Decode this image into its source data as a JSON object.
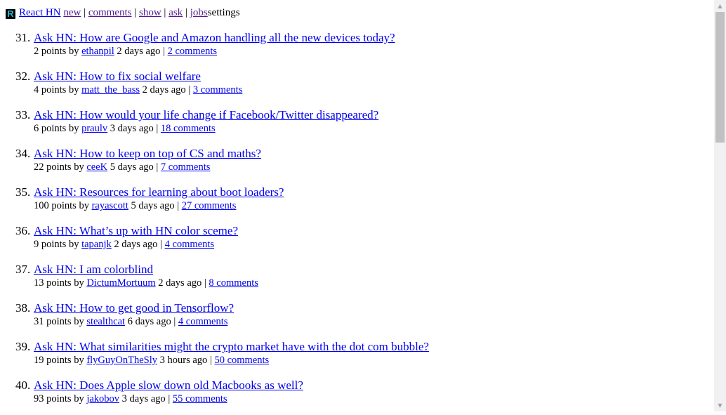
{
  "header": {
    "logo_letter": "R",
    "brand": "React HN",
    "nav": [
      {
        "label": "new",
        "visited": true
      },
      {
        "label": "comments",
        "visited": true
      },
      {
        "label": "show",
        "visited": true
      },
      {
        "label": "ask",
        "visited": true
      },
      {
        "label": "jobs",
        "visited": true
      }
    ],
    "separator": "|",
    "settings": "settings"
  },
  "stories": [
    {
      "rank": "31.",
      "title": "Ask HN: How are Google and Amazon handling all the new devices today?",
      "points": "2 points",
      "by": "by",
      "user": "ethanpil",
      "age": "2 days ago",
      "comments": "2 comments"
    },
    {
      "rank": "32.",
      "title": "Ask HN: How to fix social welfare",
      "points": "4 points",
      "by": "by",
      "user": "matt_the_bass",
      "age": "2 days ago",
      "comments": "3 comments"
    },
    {
      "rank": "33.",
      "title": "Ask HN: How would your life change if Facebook/Twitter disappeared?",
      "points": "6 points",
      "by": "by",
      "user": "praulv",
      "age": "3 days ago",
      "comments": "18 comments"
    },
    {
      "rank": "34.",
      "title": "Ask HN: How to keep on top of CS and maths?",
      "points": "22 points",
      "by": "by",
      "user": "ceeK",
      "age": "5 days ago",
      "comments": "7 comments"
    },
    {
      "rank": "35.",
      "title": "Ask HN: Resources for learning about boot loaders?",
      "points": "100 points",
      "by": "by",
      "user": "rayascott",
      "age": "5 days ago",
      "comments": "27 comments"
    },
    {
      "rank": "36.",
      "title": "Ask HN: What’s up with HN color sceme?",
      "points": "9 points",
      "by": "by",
      "user": "tapanjk",
      "age": "2 days ago",
      "comments": "4 comments"
    },
    {
      "rank": "37.",
      "title": "Ask HN: I am colorblind",
      "points": "13 points",
      "by": "by",
      "user": "DictumMortuum",
      "age": "2 days ago",
      "comments": "8 comments"
    },
    {
      "rank": "38.",
      "title": "Ask HN: How to get good in Tensorflow?",
      "points": "31 points",
      "by": "by",
      "user": "stealthcat",
      "age": "6 days ago",
      "comments": "4 comments"
    },
    {
      "rank": "39.",
      "title": "Ask HN: What similarities might the crypto market have with the dot com bubble?",
      "points": "19 points",
      "by": "by",
      "user": "flyGuyOnTheSly",
      "age": "3 hours ago",
      "comments": "50 comments"
    },
    {
      "rank": "40.",
      "title": "Ask HN: Does Apple slow down old Macbooks as well?",
      "points": "93 points",
      "by": "by",
      "user": "jakobov",
      "age": "3 days ago",
      "comments": "55 comments"
    }
  ],
  "scrollbar": {
    "up_arrow": "▲",
    "down_arrow": "▼"
  }
}
